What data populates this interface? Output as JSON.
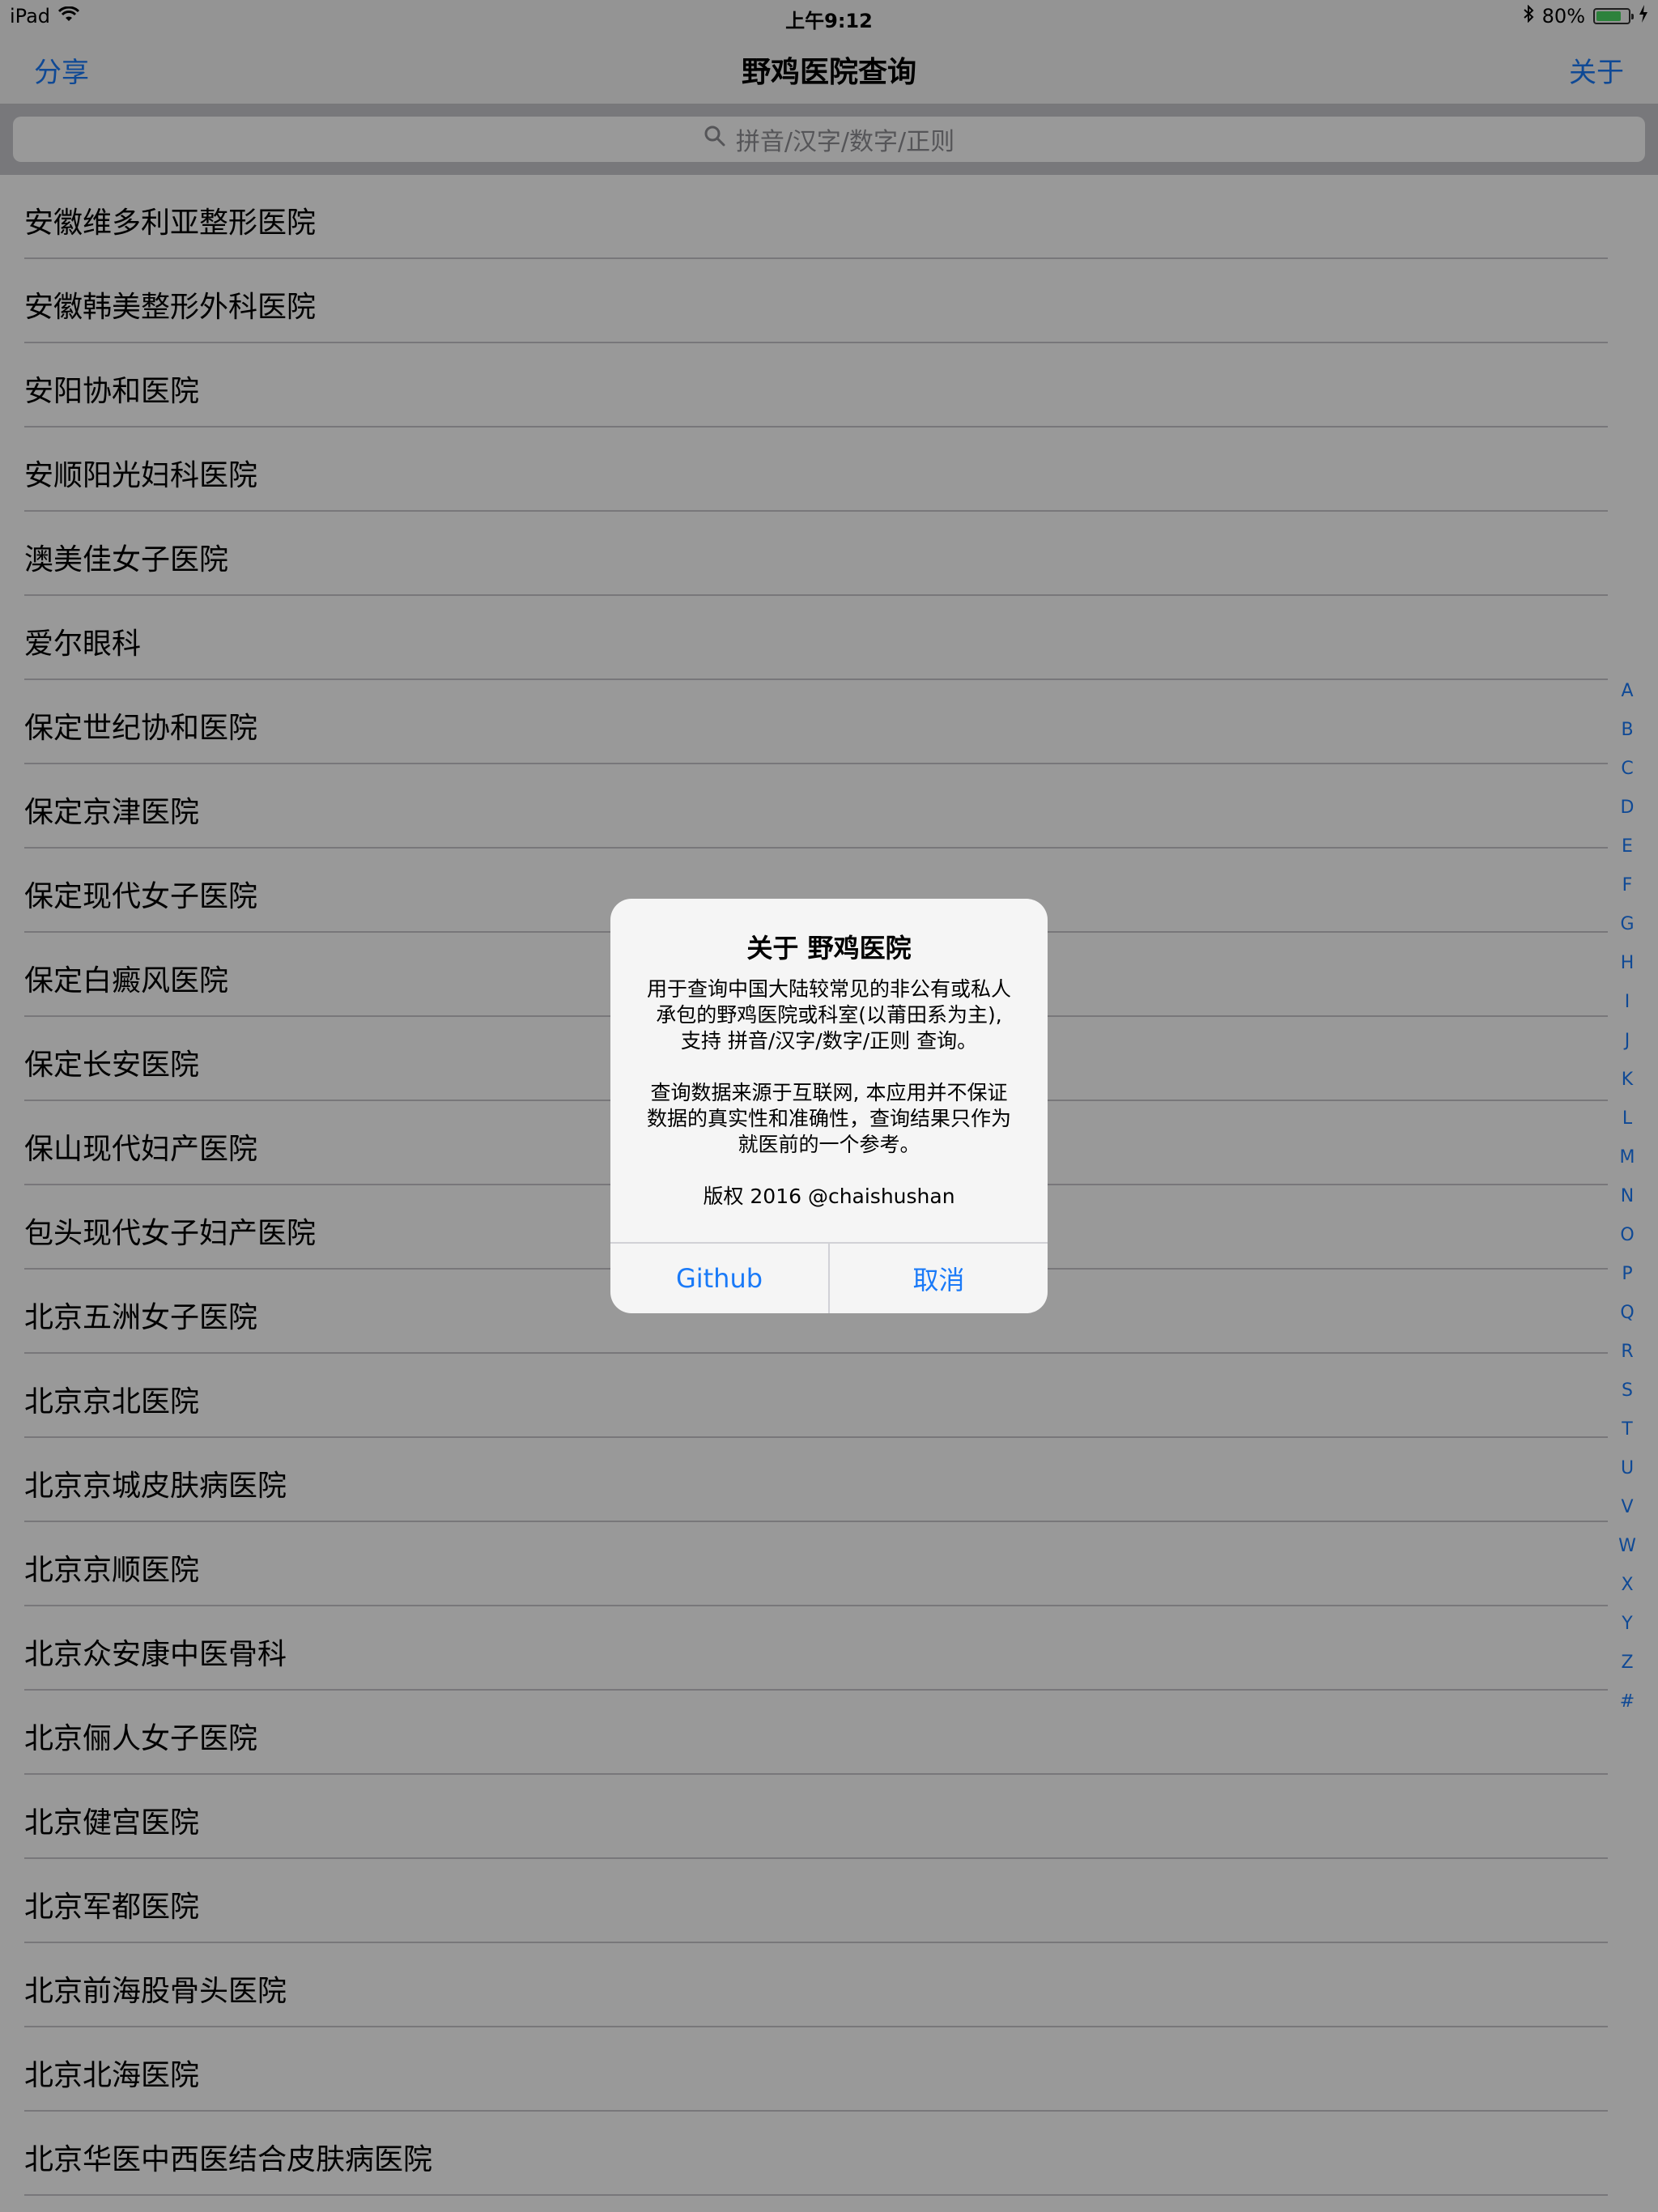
{
  "status": {
    "device": "iPad",
    "time": "上午9:12",
    "battery": "80%",
    "battery_level": 0.8
  },
  "nav": {
    "left": "分享",
    "title": "野鸡医院查询",
    "right": "关于"
  },
  "search": {
    "placeholder": "拼音/汉字/数字/正则"
  },
  "list": [
    "安徽维多利亚整形医院",
    "安徽韩美整形外科医院",
    "安阳协和医院",
    "安顺阳光妇科医院",
    "澳美佳女子医院",
    "爱尔眼科",
    "保定世纪协和医院",
    "保定京津医院",
    "保定现代女子医院",
    "保定白癜风医院",
    "保定长安医院",
    "保山现代妇产医院",
    "包头现代女子妇产医院",
    "北京五洲女子医院",
    "北京京北医院",
    "北京京城皮肤病医院",
    "北京京顺医院",
    "北京众安康中医骨科",
    "北京俪人女子医院",
    "北京健宫医院",
    "北京军都医院",
    "北京前海股骨头医院",
    "北京北海医院",
    "北京华医中西医结合皮肤病医院"
  ],
  "index": [
    "A",
    "B",
    "C",
    "D",
    "E",
    "F",
    "G",
    "H",
    "I",
    "J",
    "K",
    "L",
    "M",
    "N",
    "O",
    "P",
    "Q",
    "R",
    "S",
    "T",
    "U",
    "V",
    "W",
    "X",
    "Y",
    "Z",
    "#"
  ],
  "alert": {
    "title": "关于 野鸡医院",
    "msg1_line1": "用于查询中国大陆较常见的非公有或私人",
    "msg1_line2": "承包的野鸡医院或科室(以莆田系为主),",
    "msg1_line3": "支持 拼音/汉字/数字/正则 查询。",
    "msg2_line1": "查询数据来源于互联网, 本应用并不保证",
    "msg2_line2": "数据的真实性和准确性，查询结果只作为",
    "msg2_line3": "就医前的一个参考。",
    "copyright": "版权 2016 @chaishushan",
    "btn_github": "Github",
    "btn_cancel": "取消"
  }
}
